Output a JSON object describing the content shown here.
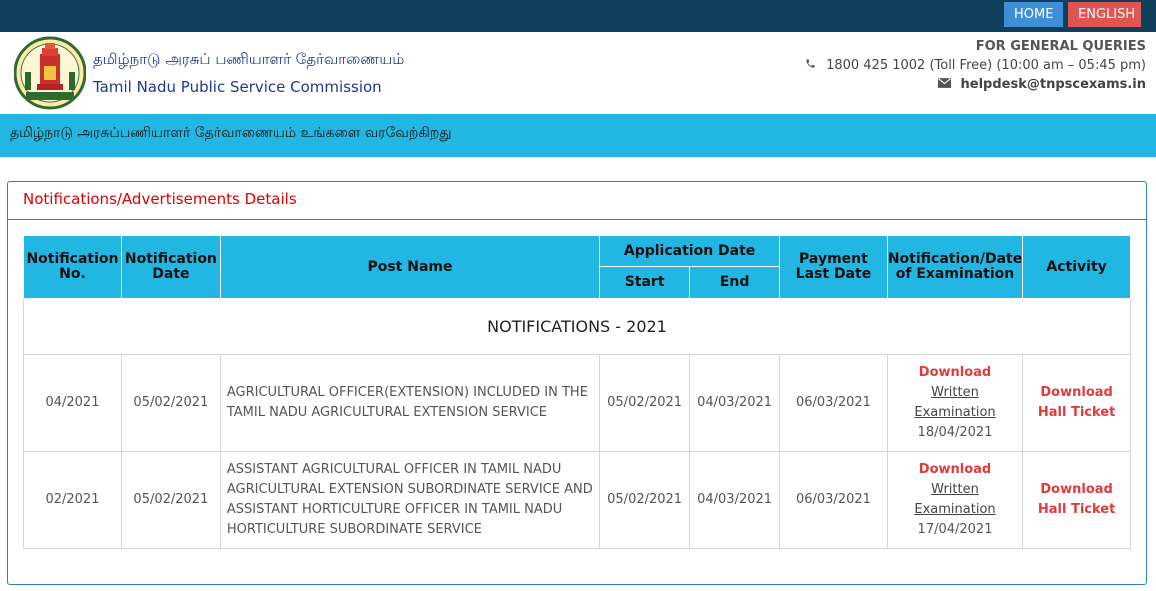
{
  "topbar": {
    "home_label": "HOME",
    "lang_label": "ENGLISH"
  },
  "header": {
    "org_name_tamil": "தமிழ்நாடு அரசுப் பணியாளர் தேர்வாணையம்",
    "org_name": "Tamil Nadu Public Service Commission",
    "queries_title": "FOR GENERAL QUERIES",
    "phone": "1800 425 1002 (Toll Free)  (10:00 am – 05:45 pm)",
    "email": "helpdesk@tnpscexams.in",
    "phone_icon": "phone-icon",
    "email_icon": "envelope-icon"
  },
  "welcome_text": "தமிழ்நாடு அரசுப்பணியாளர் தேர்வாணையம் உங்களை வரவேற்கிறது",
  "panel": {
    "title": "Notifications/Advertisements Details",
    "columns": {
      "notif_no": "Notification No.",
      "notif_date": "Notification Date",
      "post_name": "Post Name",
      "app_date": "Application Date",
      "start": "Start",
      "end": "End",
      "payment_last": "Payment Last Date",
      "exam_date": "Notification/Date of Examination",
      "activity": "Activity"
    },
    "section_title": "NOTIFICATIONS - 2021",
    "rows": [
      {
        "notif_no": "04/2021",
        "notif_date": "05/02/2021",
        "post_name": "AGRICULTURAL OFFICER(EXTENSION) INCLUDED IN THE TAMIL NADU AGRICULTURAL EXTENSION SERVICE",
        "start": "05/02/2021",
        "end": "04/03/2021",
        "payment_last": "06/03/2021",
        "download": "Download",
        "written_exam": "Written Examination",
        "exam_date": "18/04/2021",
        "activity": "Download Hall Ticket"
      },
      {
        "notif_no": "02/2021",
        "notif_date": "05/02/2021",
        "post_name": "ASSISTANT AGRICULTURAL OFFICER IN TAMIL NADU AGRICULTURAL EXTENSION SUBORDINATE SERVICE AND ASSISTANT HORTICULTURE OFFICER IN TAMIL NADU HORTICULTURE SUBORDINATE SERVICE",
        "start": "05/02/2021",
        "end": "04/03/2021",
        "payment_last": "06/03/2021",
        "download": "Download",
        "written_exam": "Written Examination",
        "exam_date": "17/04/2021",
        "activity": "Download Hall Ticket"
      }
    ]
  }
}
